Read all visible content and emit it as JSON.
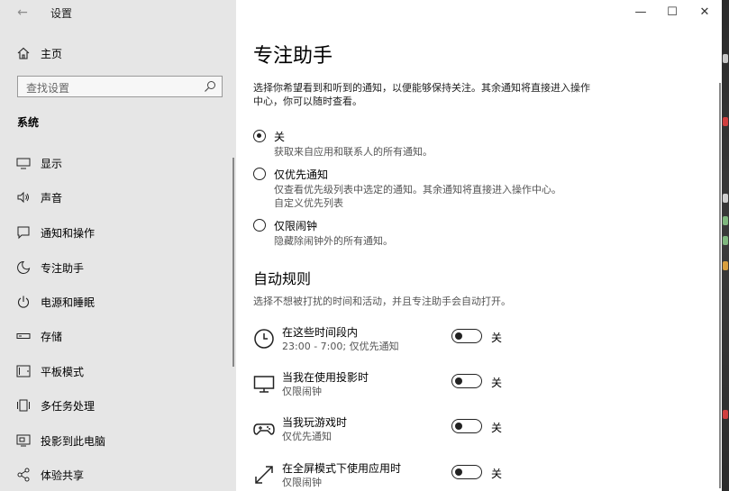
{
  "window": {
    "title": "设置"
  },
  "sidebar": {
    "home_label": "主页",
    "search_placeholder": "查找设置",
    "section": "系统",
    "items": [
      {
        "label": "显示",
        "icon": "monitor-icon"
      },
      {
        "label": "声音",
        "icon": "speaker-icon"
      },
      {
        "label": "通知和操作",
        "icon": "notification-icon"
      },
      {
        "label": "专注助手",
        "icon": "moon-icon",
        "active": true
      },
      {
        "label": "电源和睡眠",
        "icon": "power-icon"
      },
      {
        "label": "存储",
        "icon": "storage-icon"
      },
      {
        "label": "平板模式",
        "icon": "tablet-icon"
      },
      {
        "label": "多任务处理",
        "icon": "multitask-icon"
      },
      {
        "label": "投影到此电脑",
        "icon": "project-icon"
      },
      {
        "label": "体验共享",
        "icon": "share-icon"
      }
    ]
  },
  "main": {
    "title": "专注助手",
    "description": "选择你希望看到和听到的通知，以便能够保持关注。其余通知将直接进入操作中心，你可以随时查看。",
    "options": [
      {
        "label": "关",
        "sub": "获取来自应用和联系人的所有通知。",
        "checked": true
      },
      {
        "label": "仅优先通知",
        "sub": "仅查看优先级列表中选定的通知。其余通知将直接进入操作中心。",
        "link": "自定义优先列表",
        "checked": false
      },
      {
        "label": "仅限闹钟",
        "sub": "隐藏除闹钟外的所有通知。",
        "checked": false
      }
    ],
    "rules_title": "自动规则",
    "rules_desc": "选择不想被打扰的时间和活动，并且专注助手会自动打开。",
    "rules": [
      {
        "title": "在这些时间段内",
        "sub": "23:00 - 7:00; 仅优先通知",
        "state": "关",
        "icon": "clock-icon"
      },
      {
        "title": "当我在使用投影时",
        "sub": "仅限闹钟",
        "state": "关",
        "icon": "display-icon"
      },
      {
        "title": "当我玩游戏时",
        "sub": "仅优先通知",
        "state": "关",
        "icon": "gamepad-icon"
      },
      {
        "title": "在全屏模式下使用应用时",
        "sub": "仅限闹钟",
        "state": "关",
        "icon": "fullscreen-icon"
      }
    ]
  }
}
